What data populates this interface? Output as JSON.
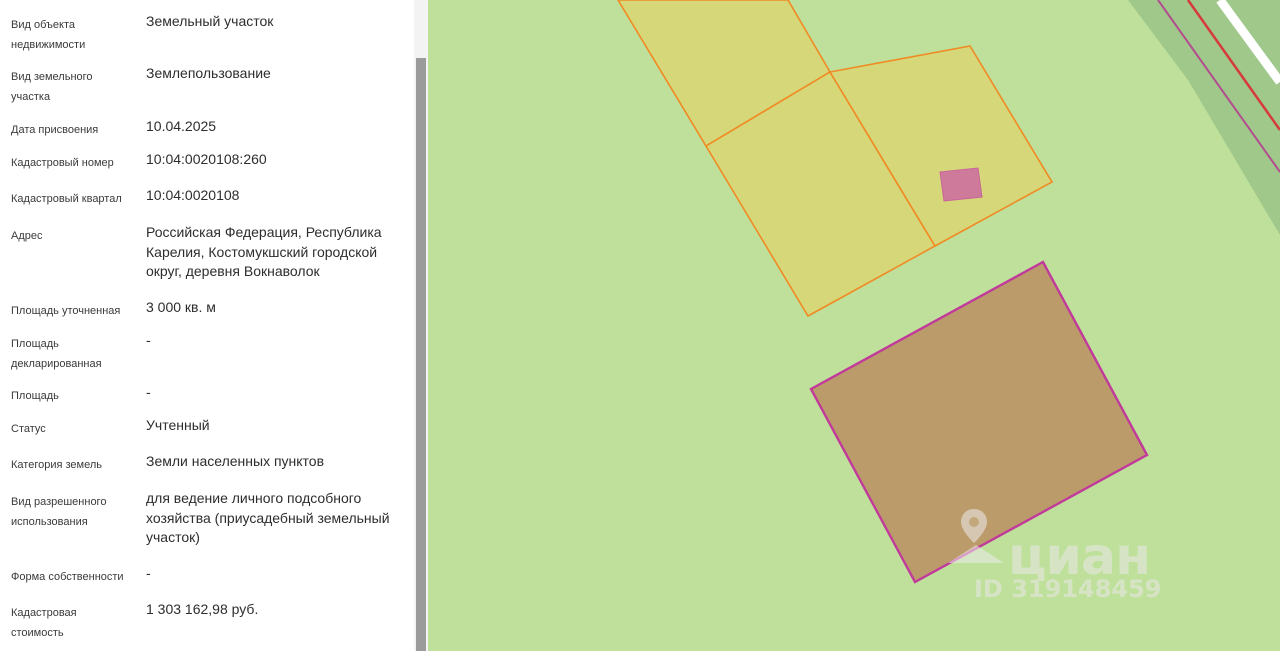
{
  "property": {
    "fields": [
      {
        "label": "Вид объекта недвижимости",
        "value": "Земельный участок"
      },
      {
        "label": "Вид земельного участка",
        "value": "Землепользование"
      },
      {
        "label": "Дата присвоения",
        "value": "10.04.2025"
      },
      {
        "label": "Кадастровый номер",
        "value": "10:04:0020108:260"
      },
      {
        "label": "Кадастровый квартал",
        "value": "10:04:0020108"
      },
      {
        "label": "Адрес",
        "value": "Российская Федерация, Республика Карелия, Костомукшский городской округ, деревня Вокнаволок"
      },
      {
        "label": "Площадь уточненная",
        "value": "3 000 кв. м"
      },
      {
        "label": "Площадь декларированная",
        "value": "-"
      },
      {
        "label": "Площадь",
        "value": "-"
      },
      {
        "label": "Статус",
        "value": "Учтенный"
      },
      {
        "label": "Категория земель",
        "value": "Земли населенных пунктов"
      },
      {
        "label": "Вид разрешенного использования",
        "value": "для ведение личного подсобного хозяйства (приусадебный земельный участок)"
      },
      {
        "label": "Форма собственности",
        "value": "-"
      },
      {
        "label": "Кадастровая стоимость",
        "value": "1 303 162,98 руб."
      }
    ]
  },
  "map": {
    "background_color": "#bfe09a",
    "neighbor_parcel_fill": "#d6d779",
    "neighbor_parcel_stroke": "#f08a24",
    "selected_parcel_fill": "#bc9b6b",
    "selected_parcel_stroke": "#c13a9b",
    "building_fill": "#cd7a9b"
  },
  "watermark": {
    "brand": "циан",
    "id_text": "ID 319148459"
  }
}
